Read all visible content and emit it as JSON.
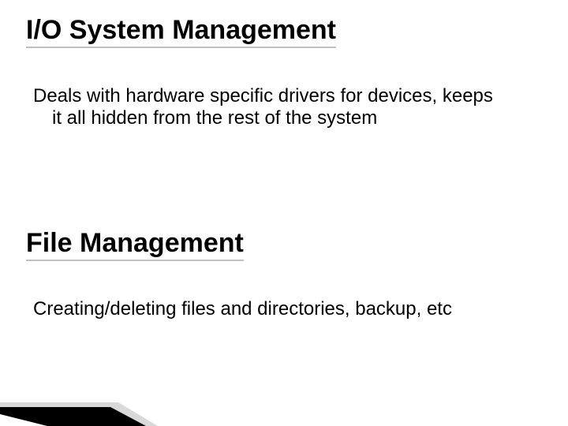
{
  "sections": [
    {
      "heading": "I/O System Management",
      "body": "Deals with hardware specific drivers for devices, keeps it all hidden from the rest of the system"
    },
    {
      "heading": "File Management",
      "body": "Creating/deleting files and directories, backup, etc"
    }
  ]
}
